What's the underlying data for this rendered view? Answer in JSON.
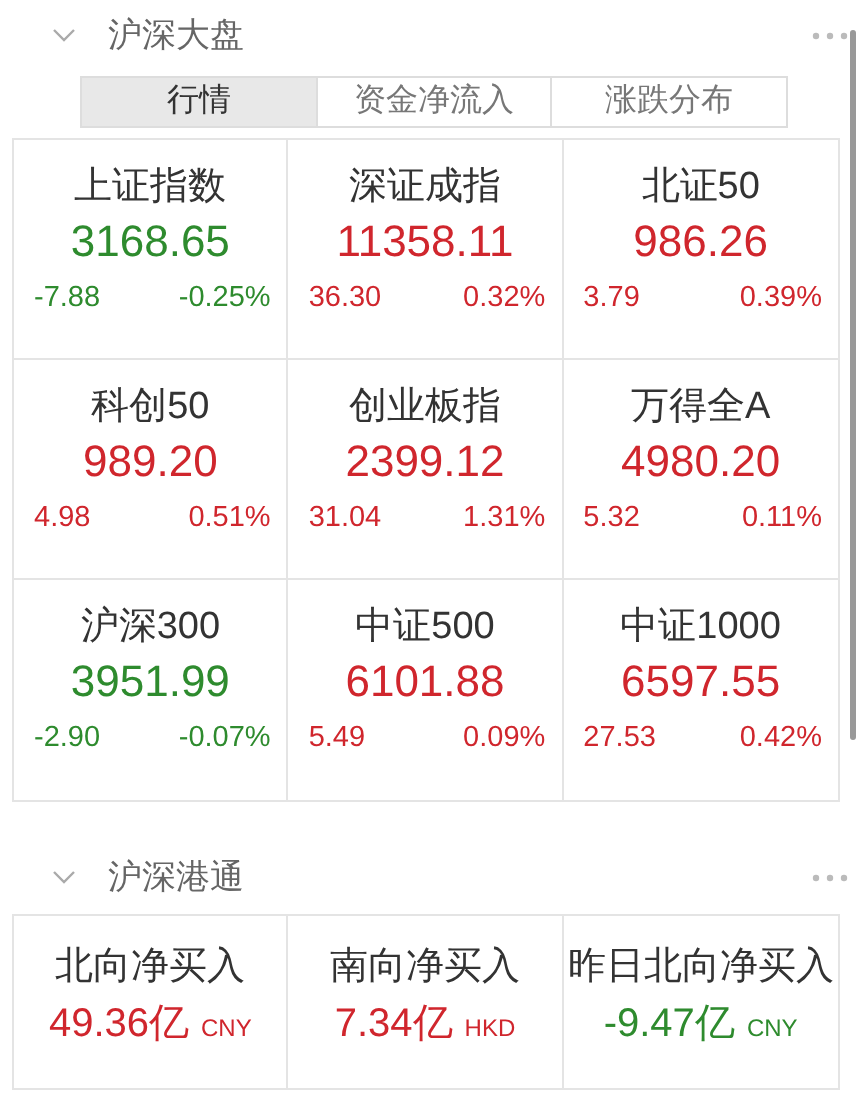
{
  "market_section": {
    "title": "沪深大盘",
    "expanded": true,
    "tabs": [
      {
        "label": "行情",
        "selected": true
      },
      {
        "label": "资金净流入",
        "selected": false
      },
      {
        "label": "涨跌分布",
        "selected": false
      }
    ],
    "indices": [
      {
        "name": "上证指数",
        "value": "3168.65",
        "change": "-7.88",
        "percent": "-0.25%",
        "color": "#2e8b2e"
      },
      {
        "name": "深证成指",
        "value": "11358.11",
        "change": "36.30",
        "percent": "0.32%",
        "color": "#d0262d"
      },
      {
        "name": "北证50",
        "value": "986.26",
        "change": "3.79",
        "percent": "0.39%",
        "color": "#d0262d"
      },
      {
        "name": "科创50",
        "value": "989.20",
        "change": "4.98",
        "percent": "0.51%",
        "color": "#d0262d"
      },
      {
        "name": "创业板指",
        "value": "2399.12",
        "change": "31.04",
        "percent": "1.31%",
        "color": "#d0262d"
      },
      {
        "name": "万得全A",
        "value": "4980.20",
        "change": "5.32",
        "percent": "0.11%",
        "color": "#d0262d"
      },
      {
        "name": "沪深300",
        "value": "3951.99",
        "change": "-2.90",
        "percent": "-0.07%",
        "color": "#2e8b2e"
      },
      {
        "name": "中证500",
        "value": "6101.88",
        "change": "5.49",
        "percent": "0.09%",
        "color": "#d0262d"
      },
      {
        "name": "中证1000",
        "value": "6597.55",
        "change": "27.53",
        "percent": "0.42%",
        "color": "#d0262d"
      }
    ]
  },
  "connect_section": {
    "title": "沪深港通",
    "expanded": true,
    "flows": [
      {
        "name": "北向净买入",
        "value": "49.36亿",
        "currency": "CNY",
        "color": "#d0262d"
      },
      {
        "name": "南向净买入",
        "value": "7.34亿",
        "currency": "HKD",
        "color": "#d0262d"
      },
      {
        "name": "昨日北向净买入",
        "value": "-9.47亿",
        "currency": "CNY",
        "color": "#2e8b2e"
      }
    ]
  }
}
